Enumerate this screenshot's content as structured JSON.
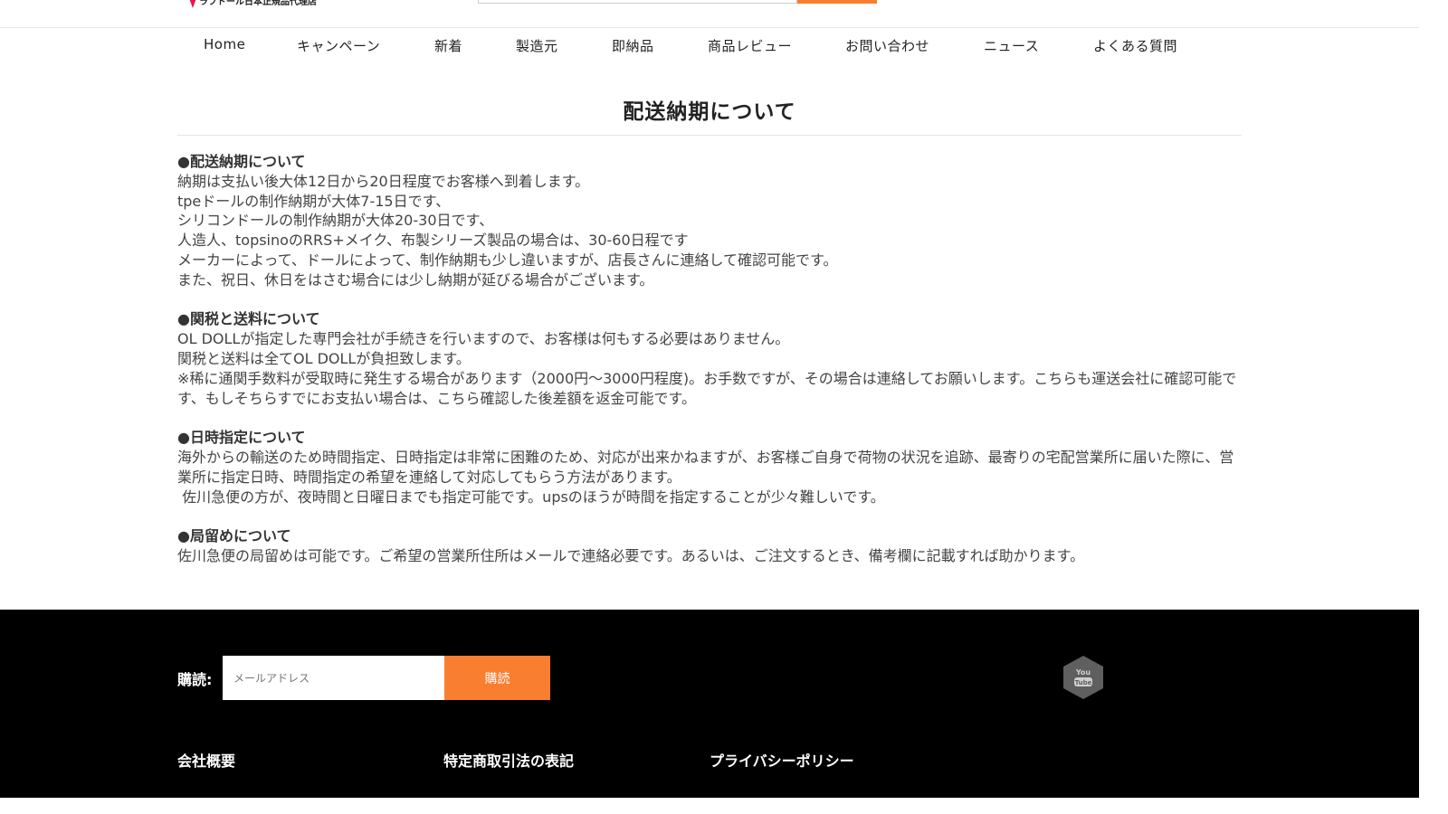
{
  "header": {
    "logo_subtitle": "ラブドール日本正規品代理店"
  },
  "nav": {
    "items": [
      {
        "label": "Home"
      },
      {
        "label": "キャンペーン"
      },
      {
        "label": "新着"
      },
      {
        "label": "製造元"
      },
      {
        "label": "即納品"
      },
      {
        "label": "商品レビュー"
      },
      {
        "label": "お問い合わせ"
      },
      {
        "label": "ニュース"
      },
      {
        "label": "よくある質問"
      }
    ]
  },
  "page": {
    "title": "配送納期について",
    "sections": [
      {
        "heading": "●配送納期について",
        "lines": [
          "納期は支払い後大体12日から20日程度でお客様へ到着します。",
          "tpeドールの制作納期が大体7-15日です、",
          "シリコンドールの制作納期が大体20-30日です、",
          "人造人、topsinoのRRS+メイク、布製シリーズ製品の場合は、30-60日程です",
          "メーカーによって、ドールによって、制作納期も少し違いますが、店長さんに連絡して確認可能です。",
          "また、祝日、休日をはさむ場合には少し納期が延びる場合がございます。"
        ]
      },
      {
        "heading": "●関税と送料について",
        "lines": [
          "OL DOLLが指定した専門会社が手続きを行いますので、お客様は何もする必要はありません。",
          "関税と送料は全てOL DOLLが負担致します。",
          "※稀に通関手数料が受取時に発生する場合があります（2000円～3000円程度)。お手数ですが、その場合は連絡してお願いします。こちらも運送会社に確認可能です、もしそちらすでにお支払い場合は、こちら確認した後差額を返金可能です。"
        ]
      },
      {
        "heading": "●日時指定について",
        "lines": [
          "海外からの輸送のため時間指定、日時指定は非常に困難のため、対応が出来かねますが、お客様ご自身で荷物の状況を追跡、最寄りの宅配営業所に届いた際に、営業所に指定日時、時間指定の希望を連絡して対応してもらう方法があります。",
          " 佐川急便の方が、夜時間と日曜日までも指定可能です。upsのほうが時間を指定することが少々難しいです。"
        ]
      },
      {
        "heading": "●局留めについて",
        "lines": [
          "佐川急便の局留めは可能です。ご希望の営業所住所はメールで連絡必要です。あるいは、ご注文するとき、備考欄に記載すれば助かります。"
        ]
      }
    ]
  },
  "footer": {
    "subscribe_label": "購読:",
    "email_placeholder": "メールアドレス",
    "subscribe_button": "購読",
    "social_icon": "youtube-icon",
    "columns": [
      {
        "title": "会社概要"
      },
      {
        "title": "特定商取引法の表記"
      },
      {
        "title": "プライバシーポリシー"
      }
    ]
  },
  "colors": {
    "accent": "#fa7e2f",
    "footer_bg": "#000000",
    "logo_red": "#e8164c"
  }
}
